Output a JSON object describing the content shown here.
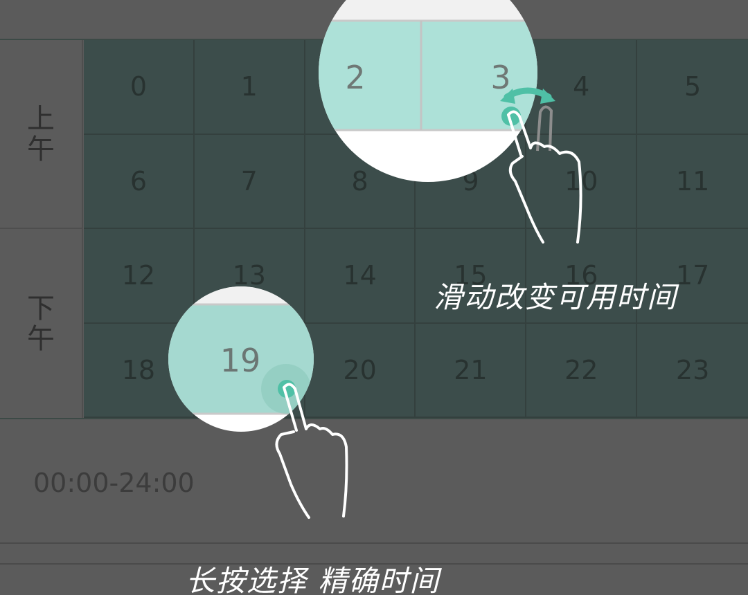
{
  "periods": {
    "am": "上午",
    "pm": "下午"
  },
  "hours": [
    "0",
    "1",
    "2",
    "3",
    "4",
    "5",
    "6",
    "7",
    "8",
    "9",
    "10",
    "11",
    "12",
    "13",
    "14",
    "15",
    "16",
    "17",
    "18",
    "19",
    "20",
    "21",
    "22",
    "23"
  ],
  "range": "00:00-24:00",
  "hints": {
    "slide": "滑动改变可用时间",
    "long_press": "长按选择 精确时间"
  },
  "magnifier_top": {
    "cells": [
      "2",
      "3"
    ]
  },
  "magnifier_bottom": {
    "cell": "19"
  },
  "colors": {
    "grid_bg": "#3c4d4b",
    "highlight": "#ade1d8",
    "accent": "#4fc0a6",
    "background": "#5b5b5b"
  },
  "icons": [
    "pointing-hand-icon",
    "swipe-arrow-icon",
    "touch-point-icon"
  ]
}
